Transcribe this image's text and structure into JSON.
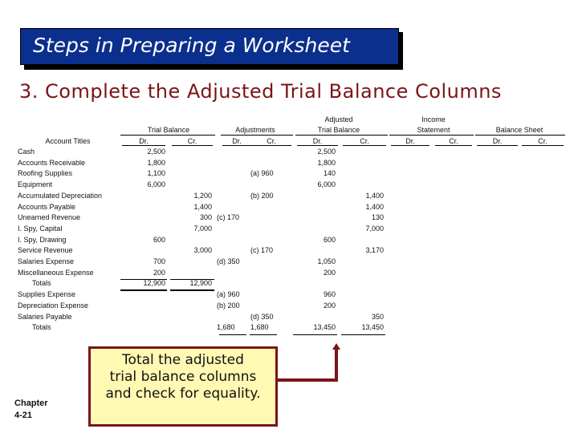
{
  "slide": {
    "title": "Steps in Preparing a Worksheet",
    "subtitle": "3. Complete the Adjusted Trial Balance Columns",
    "callout": [
      "Total the adjusted",
      "trial balance columns",
      "and check for equality."
    ],
    "chapter_label": "Chapter",
    "chapter_page": "4-21",
    "colors": {
      "title_bg": "#0b2f8c",
      "subtitle": "#7a1418",
      "callout_bg": "#fff9b3",
      "callout_border": "#7a1418"
    }
  },
  "worksheet": {
    "groups": {
      "trial_balance": "Trial Balance",
      "adjustments": "Adjustments",
      "adjusted_line1": "Adjusted",
      "adjusted_line2": "Trial Balance",
      "income_line1": "Income",
      "income_line2": "Statement",
      "balance_sheet": "Balance Sheet"
    },
    "account_titles_header": "Account Titles",
    "dr": "Dr.",
    "cr": "Cr.",
    "rows": [
      {
        "title": "Cash",
        "tb_dr": "2,500",
        "tb_cr": "",
        "adj_dr": "",
        "adj_cr": "",
        "atb_dr": "2,500",
        "atb_cr": ""
      },
      {
        "title": "Accounts Receivable",
        "tb_dr": "1,800",
        "tb_cr": "",
        "adj_dr": "",
        "adj_cr": "",
        "atb_dr": "1,800",
        "atb_cr": ""
      },
      {
        "title": "Roofing Supplies",
        "tb_dr": "1,100",
        "tb_cr": "",
        "adj_dr": "",
        "adj_cr": "(a)  960",
        "atb_dr": "140",
        "atb_cr": ""
      },
      {
        "title": "Equipment",
        "tb_dr": "6,000",
        "tb_cr": "",
        "adj_dr": "",
        "adj_cr": "",
        "atb_dr": "6,000",
        "atb_cr": ""
      },
      {
        "title": "Accumulated Depreciation",
        "tb_dr": "",
        "tb_cr": "1,200",
        "adj_dr": "",
        "adj_cr": "(b)  200",
        "atb_dr": "",
        "atb_cr": "1,400"
      },
      {
        "title": "Accounts Payable",
        "tb_dr": "",
        "tb_cr": "1,400",
        "adj_dr": "",
        "adj_cr": "",
        "atb_dr": "",
        "atb_cr": "1,400"
      },
      {
        "title": "Unearned Revenue",
        "tb_dr": "",
        "tb_cr": "300",
        "adj_dr": "(c)  170",
        "adj_cr": "",
        "atb_dr": "",
        "atb_cr": "130"
      },
      {
        "title": "I. Spy, Capital",
        "tb_dr": "",
        "tb_cr": "7,000",
        "adj_dr": "",
        "adj_cr": "",
        "atb_dr": "",
        "atb_cr": "7,000"
      },
      {
        "title": "I. Spy, Drawing",
        "tb_dr": "600",
        "tb_cr": "",
        "adj_dr": "",
        "adj_cr": "",
        "atb_dr": "600",
        "atb_cr": ""
      },
      {
        "title": "Service Revenue",
        "tb_dr": "",
        "tb_cr": "3,000",
        "adj_dr": "",
        "adj_cr": "(c)  170",
        "atb_dr": "",
        "atb_cr": "3,170"
      },
      {
        "title": "Salaries Expense",
        "tb_dr": "700",
        "tb_cr": "",
        "adj_dr": "(d)  350",
        "adj_cr": "",
        "atb_dr": "1,050",
        "atb_cr": ""
      },
      {
        "title": "Miscellaneous Expense",
        "tb_dr": "200",
        "tb_cr": "",
        "adj_dr": "",
        "adj_cr": "",
        "atb_dr": "200",
        "atb_cr": ""
      },
      {
        "title": "   Totals",
        "tb_dr": "12,900",
        "tb_cr": "12,900",
        "adj_dr": "",
        "adj_cr": "",
        "atb_dr": "",
        "atb_cr": ""
      },
      {
        "title": "Supplies Expense",
        "tb_dr": "",
        "tb_cr": "",
        "adj_dr": "(a)  960",
        "adj_cr": "",
        "atb_dr": "960",
        "atb_cr": ""
      },
      {
        "title": "Depreciation Expense",
        "tb_dr": "",
        "tb_cr": "",
        "adj_dr": "(b)  200",
        "adj_cr": "",
        "atb_dr": "200",
        "atb_cr": ""
      },
      {
        "title": "Salaries Payable",
        "tb_dr": "",
        "tb_cr": "",
        "adj_dr": "",
        "adj_cr": "(d)  350",
        "atb_dr": "",
        "atb_cr": "350"
      },
      {
        "title": "   Totals",
        "tb_dr": "",
        "tb_cr": "",
        "adj_dr": "1,680",
        "adj_cr": "1,680",
        "atb_dr": "13,450",
        "atb_cr": "13,450"
      }
    ]
  }
}
